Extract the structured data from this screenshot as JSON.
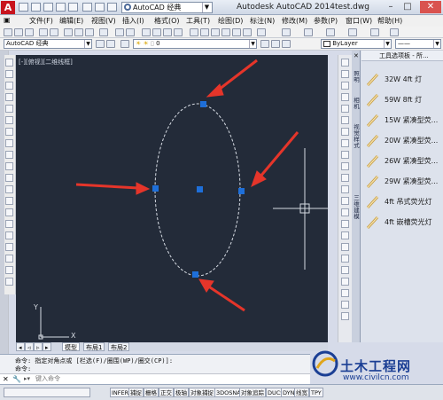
{
  "titlebar": {
    "logo": "A",
    "workspace": "AutoCAD 经典",
    "app_title": "Autodesk AutoCAD 2014",
    "file_title": "test.dwg",
    "minimize": "–",
    "maximize": "□",
    "close": "✕"
  },
  "menu": {
    "items": [
      "文件(F)",
      "编辑(E)",
      "视图(V)",
      "插入(I)",
      "格式(O)",
      "工具(T)",
      "绘图(D)",
      "标注(N)",
      "修改(M)",
      "参数(P)",
      "窗口(W)",
      "帮助(H)"
    ]
  },
  "toolbar": {
    "workspace_combo": "AutoCAD 经典",
    "layer_value": "0",
    "linetype_value": "ByLayer"
  },
  "canvas": {
    "view_label": "[-][俯视][二维线框]",
    "ucs_y": "Y",
    "ucs_x": "X",
    "background": "#232b39",
    "grip_color": "#1e6fd9",
    "arrow_color": "#e5352a"
  },
  "layout_tabs": [
    "模型",
    "布局1",
    "布局2"
  ],
  "command": {
    "line1": "命令: 指定对角点或 [栏选(F)/圈围(WP)/圈交(CP)]:",
    "line2": "命令:",
    "input_placeholder": "键入命令"
  },
  "status": {
    "buttons": [
      "INFER",
      "捕捉",
      "栅格",
      "正交",
      "极轴",
      "对象捕捉",
      "3DOSNAP",
      "对象追踪",
      "DUCS",
      "DYN",
      "线宽",
      "TPY"
    ]
  },
  "palette": {
    "title": "工具选项板 - 所...",
    "tabs": [
      "照明",
      "相机",
      "视觉样式",
      "三维建模"
    ],
    "items": [
      {
        "label": "32W 4ft 灯"
      },
      {
        "label": "59W 8ft 灯"
      },
      {
        "label": "15W 紧凑型荧..."
      },
      {
        "label": "20W 紧凑型荧..."
      },
      {
        "label": "26W 紧凑型荧..."
      },
      {
        "label": "29W 紧凑型荧..."
      },
      {
        "label": "4ft 吊式荧光灯"
      },
      {
        "label": "4ft 嵌槽荧光灯"
      }
    ]
  },
  "watermark": {
    "name": "土木工程网",
    "url": "www.civilcn.com"
  }
}
